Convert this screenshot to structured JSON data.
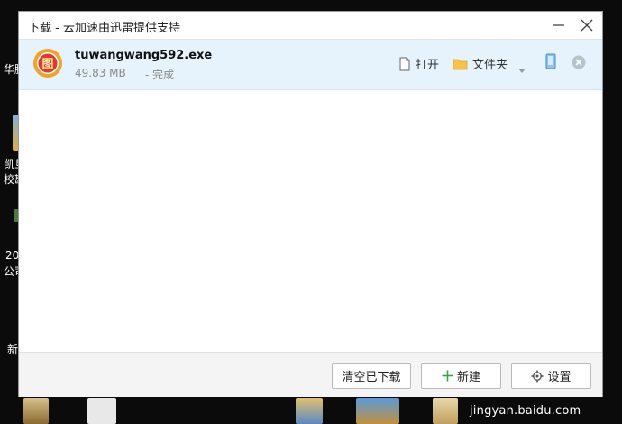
{
  "desktop": {
    "labels": [
      "华腾",
      "凯旦",
      "校勘",
      "20",
      "公司",
      "新"
    ]
  },
  "window": {
    "title": "下载 - 云加速由迅雷提供支持"
  },
  "download": {
    "file_name": "tuwangwang592.exe",
    "file_size": "49.83 MB",
    "status": "- 完成",
    "icon_glyph": "图",
    "open_label": "打开",
    "folder_label": "文件夹"
  },
  "footer": {
    "clear_label": "清空已下载",
    "new_label": "新建",
    "settings_label": "设置"
  },
  "watermark": "jingyan.baidu.com",
  "colors": {
    "item_bg": "#e6f3fc",
    "new_plus": "#35a64a",
    "folder": "#f6c342",
    "phone": "#3b8fd8"
  }
}
